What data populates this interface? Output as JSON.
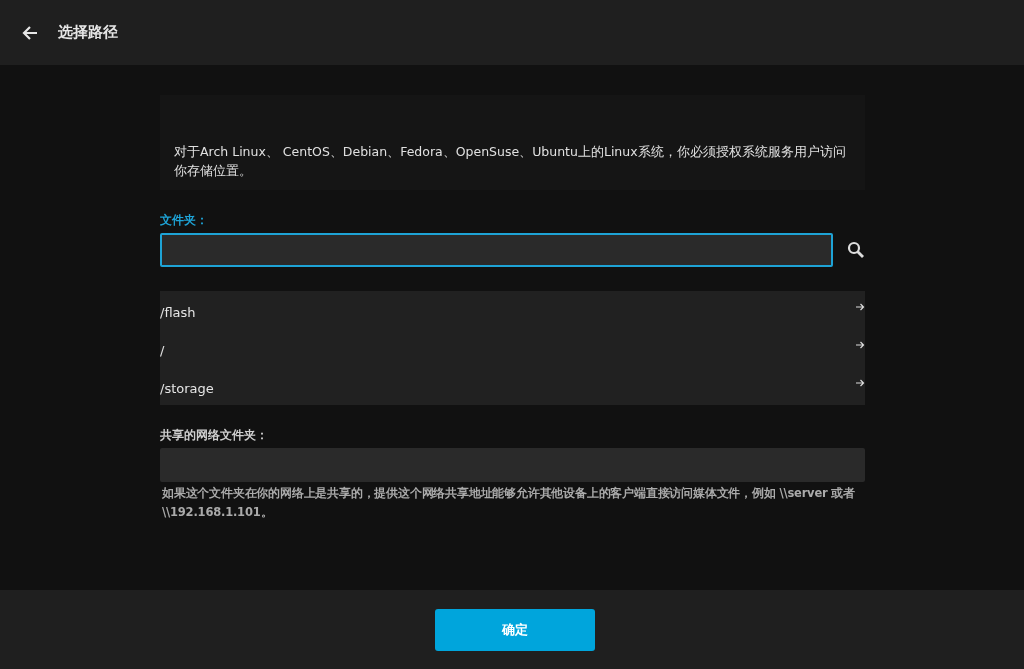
{
  "header": {
    "title": "选择路径"
  },
  "notice": "对于Arch Linux、 CentOS、Debian、Fedora、OpenSuse、Ubuntu上的Linux系统，你必须授权系统服务用户访问你存储位置。",
  "folder": {
    "label": "文件夹：",
    "focused": true
  },
  "paths": [
    {
      "label": "/flash"
    },
    {
      "label": "/"
    },
    {
      "label": "/storage"
    }
  ],
  "network": {
    "label": "共享的网络文件夹：",
    "hint": "如果这个文件夹在你的网络上是共享的，提供这个网络共享地址能够允许其他设备上的客户端直接访问媒体文件，例如 \\\\server 或者 \\\\192.168.1.101。"
  },
  "footer": {
    "button": "确定"
  }
}
